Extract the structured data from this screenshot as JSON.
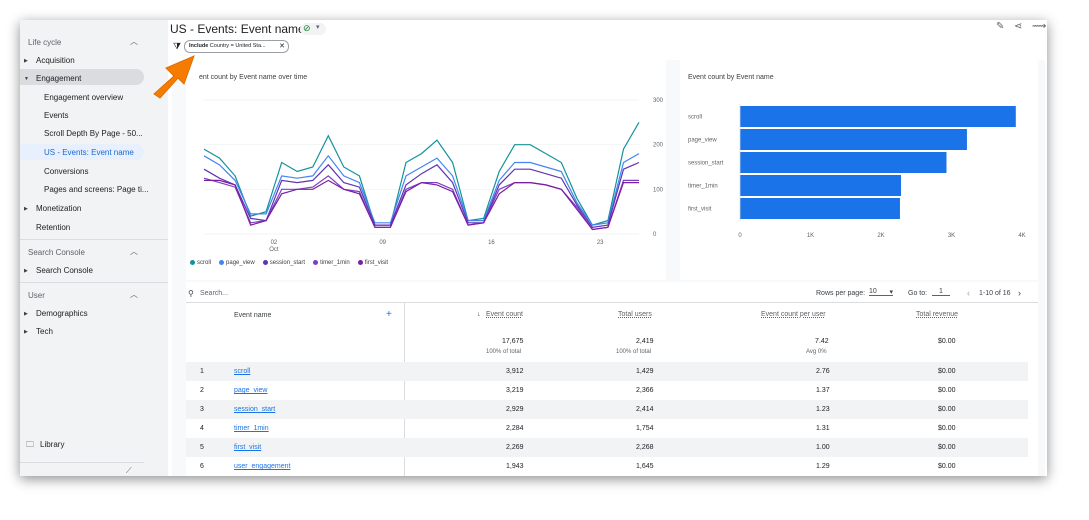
{
  "sidebar": {
    "lifecycle": {
      "header": "Life cycle",
      "items": [
        {
          "label": "Acquisition"
        },
        {
          "label": "Engagement"
        },
        {
          "label": "Engagement overview"
        },
        {
          "label": "Events"
        },
        {
          "label": "Scroll Depth By Page - 50..."
        },
        {
          "label": "US - Events: Event name"
        },
        {
          "label": "Conversions"
        },
        {
          "label": "Pages and screens: Page ti..."
        },
        {
          "label": "Monetization"
        },
        {
          "label": "Retention"
        }
      ]
    },
    "search_console": {
      "header": "Search Console",
      "items": [
        {
          "label": "Search Console"
        }
      ]
    },
    "user": {
      "header": "User",
      "items": [
        {
          "label": "Demographics"
        },
        {
          "label": "Tech"
        }
      ]
    },
    "library": "Library"
  },
  "header": {
    "title": "US - Events: Event name",
    "filter_include": "Include",
    "filter_value": "Country = United Sta..."
  },
  "line_chart": {
    "title": "Event count by Event name over time",
    "title_visible": "ent count by Event name over time"
  },
  "bar_chart": {
    "title": "Event count by Event name"
  },
  "chart_data": [
    {
      "type": "line",
      "title": "Event count by Event name over time",
      "x": [
        26,
        27,
        28,
        29,
        30,
        1,
        2,
        3,
        4,
        5,
        6,
        7,
        8,
        9,
        10,
        11,
        12,
        13,
        14,
        15,
        16,
        17,
        18,
        19,
        20,
        21,
        22,
        23,
        24,
        25,
        26
      ],
      "x_ticks": [
        {
          "value": "02",
          "sub": "Oct"
        },
        {
          "value": "09"
        },
        {
          "value": "16"
        },
        {
          "value": "23"
        }
      ],
      "ylim": [
        0,
        300
      ],
      "y_ticks": [
        "0",
        "100",
        "200",
        "300"
      ],
      "series": [
        {
          "name": "scroll",
          "color": "#12939a",
          "values": [
            190,
            170,
            130,
            40,
            50,
            160,
            140,
            150,
            220,
            150,
            130,
            20,
            20,
            160,
            180,
            210,
            160,
            30,
            35,
            140,
            200,
            200,
            180,
            160,
            80,
            20,
            30,
            190,
            250
          ]
        },
        {
          "name": "page_view",
          "color": "#4285f4",
          "values": [
            175,
            155,
            120,
            45,
            45,
            130,
            125,
            130,
            175,
            130,
            115,
            25,
            25,
            130,
            150,
            170,
            130,
            30,
            30,
            120,
            160,
            160,
            150,
            140,
            70,
            20,
            25,
            160,
            180
          ]
        },
        {
          "name": "session_start",
          "color": "#5e35b1",
          "values": [
            145,
            125,
            110,
            35,
            30,
            120,
            115,
            120,
            155,
            115,
            105,
            20,
            20,
            110,
            135,
            155,
            115,
            25,
            25,
            110,
            145,
            145,
            135,
            125,
            65,
            15,
            20,
            145,
            160
          ]
        },
        {
          "name": "timer_1min",
          "color": "#7b3fc4",
          "values": [
            125,
            115,
            105,
            25,
            30,
            100,
            100,
            105,
            130,
            100,
            95,
            15,
            15,
            100,
            115,
            115,
            100,
            20,
            25,
            100,
            115,
            115,
            110,
            100,
            60,
            10,
            15,
            120,
            120
          ]
        },
        {
          "name": "first_visit",
          "color": "#7b1fa2",
          "values": [
            120,
            120,
            110,
            20,
            30,
            90,
            100,
            100,
            120,
            100,
            90,
            15,
            15,
            95,
            115,
            110,
            95,
            20,
            25,
            90,
            115,
            115,
            110,
            100,
            55,
            10,
            15,
            115,
            115
          ]
        }
      ]
    },
    {
      "type": "bar",
      "title": "Event count by Event name",
      "categories": [
        "scroll",
        "page_view",
        "session_start",
        "timer_1min",
        "first_visit"
      ],
      "values": [
        3912,
        3219,
        2929,
        2284,
        2269
      ],
      "xlim": [
        0,
        4000
      ],
      "x_ticks": [
        "0",
        "1K",
        "2K",
        "3K",
        "4K"
      ]
    }
  ],
  "table": {
    "search_placeholder": "Search...",
    "rows_per_page_label": "Rows per page:",
    "rows_per_page_value": "10",
    "goto_label": "Go to:",
    "goto_value": "1",
    "range": "1-10 of 16",
    "columns": [
      "Event name",
      "Event count",
      "Total users",
      "Event count per user",
      "Total revenue"
    ],
    "totals": {
      "event_count": "17,675",
      "event_count_sub": "100% of total",
      "total_users": "2,419",
      "total_users_sub": "100% of total",
      "per_user": "7.42",
      "per_user_sub": "Avg 0%",
      "revenue": "$0.00"
    },
    "rows": [
      {
        "idx": "1",
        "name": "scroll",
        "count": "3,912",
        "users": "1,429",
        "per_user": "2.76",
        "revenue": "$0.00"
      },
      {
        "idx": "2",
        "name": "page_view",
        "count": "3,219",
        "users": "2,366",
        "per_user": "1.37",
        "revenue": "$0.00"
      },
      {
        "idx": "3",
        "name": "session_start",
        "count": "2,929",
        "users": "2,414",
        "per_user": "1.23",
        "revenue": "$0.00"
      },
      {
        "idx": "4",
        "name": "timer_1min",
        "count": "2,284",
        "users": "1,754",
        "per_user": "1.31",
        "revenue": "$0.00"
      },
      {
        "idx": "5",
        "name": "first_visit",
        "count": "2,269",
        "users": "2,268",
        "per_user": "1.00",
        "revenue": "$0.00"
      },
      {
        "idx": "6",
        "name": "user_engagement",
        "count": "1,943",
        "users": "1,645",
        "per_user": "1.29",
        "revenue": "$0.00"
      }
    ]
  },
  "colors": {
    "accent": "#1a73e8",
    "bar": "#1a73e8",
    "arrow": "#f57c00"
  }
}
